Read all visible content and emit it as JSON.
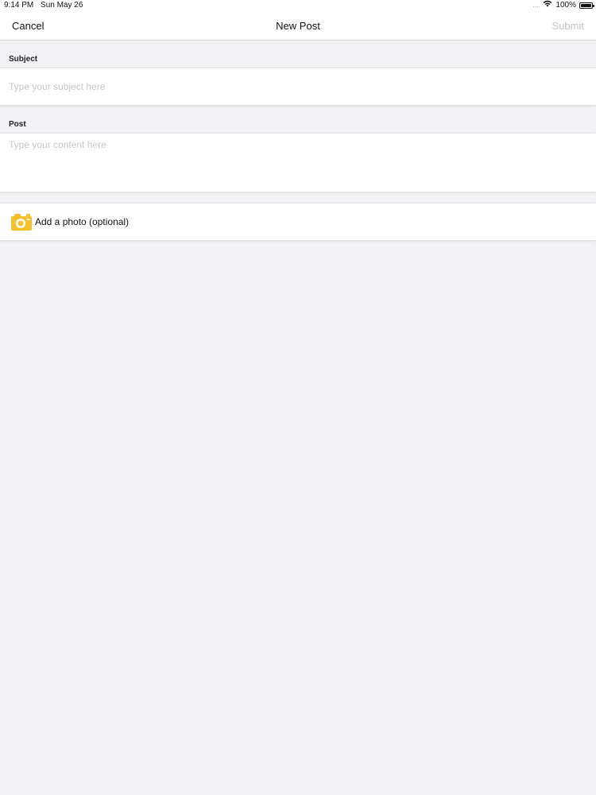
{
  "status_bar": {
    "time": "9:14 PM",
    "date": "Sun May 26",
    "signal": "....",
    "wifi_icon": "wifi-icon",
    "battery_percent": "100%",
    "battery_icon": "battery-icon"
  },
  "nav": {
    "cancel_label": "Cancel",
    "title": "New Post",
    "submit_label": "Submit"
  },
  "subject": {
    "label": "Subject",
    "placeholder": "Type your subject here",
    "value": ""
  },
  "post": {
    "label": "Post",
    "placeholder": "Type your content here",
    "value": ""
  },
  "photo": {
    "label": "Add a photo (optional)",
    "icon": "camera-icon",
    "icon_color": "#F5C02E"
  },
  "colors": {
    "background": "#F2F2F5",
    "submit_disabled": "#C4C4C8",
    "placeholder": "#C7C7CC"
  }
}
